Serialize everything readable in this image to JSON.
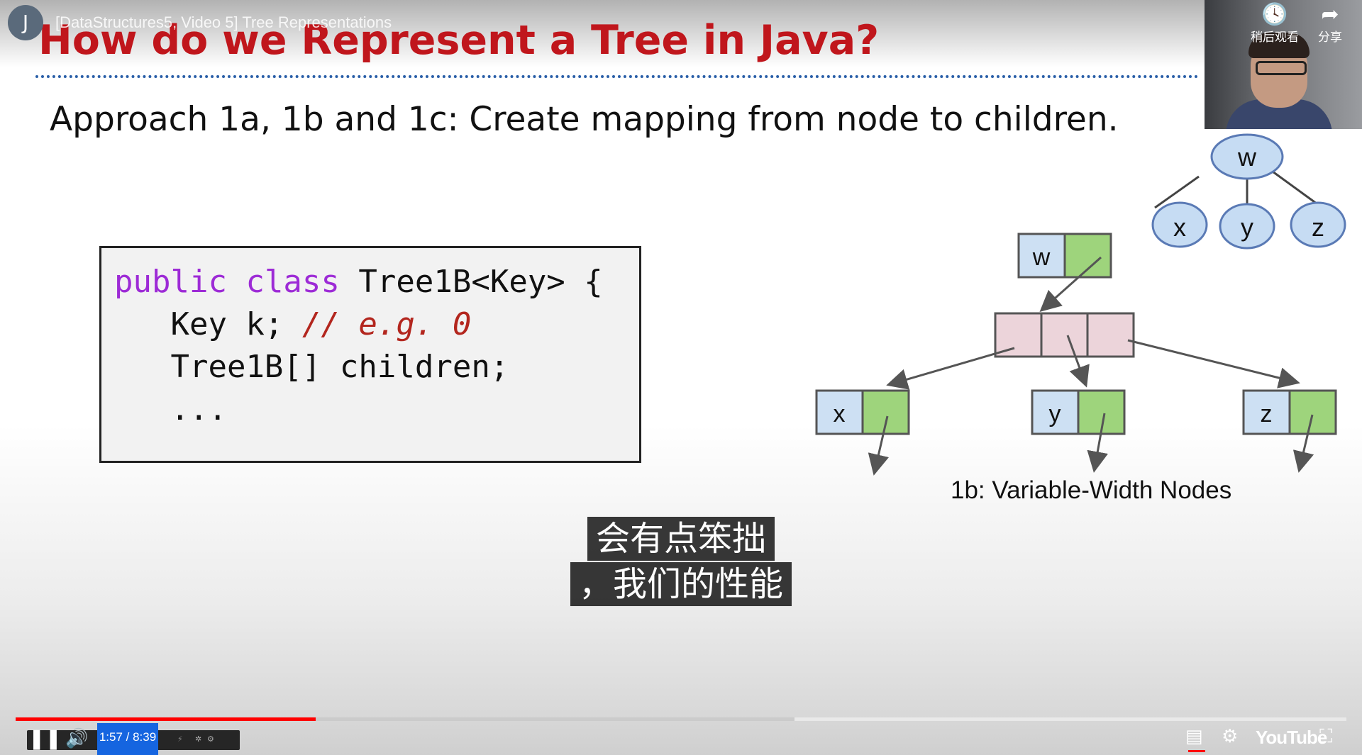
{
  "video": {
    "channel_initial": "J",
    "title": "[DataStructures5, Video 5] Tree Representations",
    "watch_later_label": "稍后观看",
    "share_label": "分享"
  },
  "slide": {
    "title": "How do we Represent a Tree in Java?",
    "approach": "Approach 1a, 1b and 1c: Create mapping from node to children.",
    "code": {
      "line1_kw1": "public",
      "line1_kw2": "class",
      "line1_rest": "Tree1B<Key> {",
      "line2_code": "Key k;",
      "line2_comment": "// e.g. 0",
      "line3": "Tree1B[] children;",
      "line4": "..."
    },
    "tree": {
      "root": "w",
      "children": [
        "x",
        "y",
        "z"
      ]
    },
    "nodes": {
      "w": "w",
      "x": "x",
      "y": "y",
      "z": "z"
    },
    "caption": "1b: Variable-Width Nodes"
  },
  "subtitles": {
    "line1": "会有点笨拙",
    "line2": "，我们的性能"
  },
  "player": {
    "time": "1:57 / 8:39",
    "played_fraction": 0.2256,
    "buffered_fraction": 0.5855,
    "logo": "YouTube",
    "colors": {
      "progress": "#ff0000",
      "time_highlight": "#1565e0"
    }
  },
  "icons": [
    "pause-icon",
    "volume-icon",
    "watch-later-icon",
    "share-icon",
    "captions-icon",
    "settings-icon",
    "exit-fullscreen-icon"
  ]
}
